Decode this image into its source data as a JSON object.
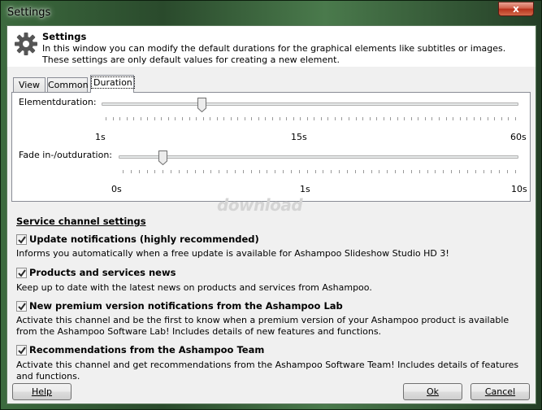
{
  "window": {
    "title": "Settings",
    "close_glyph": "x"
  },
  "header": {
    "title": "Settings",
    "description": "In this window you can modify the default durations for the graphical elements like subtitles or images. These settings are only default values for creating a new element.",
    "icon": "gear-icon"
  },
  "tabs": [
    {
      "label": "View",
      "active": false
    },
    {
      "label": "Common",
      "active": false
    },
    {
      "label": "Duration",
      "active": true
    }
  ],
  "duration": {
    "element": {
      "label": "Elementduration:",
      "min_label": "1s",
      "mid_label": "15s",
      "max_label": "60s",
      "value_fraction": 0.24
    },
    "fade": {
      "label": "Fade in-/outduration:",
      "min_label": "0s",
      "mid_label": "1s",
      "max_label": "10s",
      "value_fraction": 0.11
    }
  },
  "watermark": "download",
  "service": {
    "title": "Service channel settings",
    "items": [
      {
        "label": "Update notifications (highly recommended)",
        "checked": true,
        "description": "Informs you automatically when a free update is available for Ashampoo Slideshow Studio HD 3!"
      },
      {
        "label": "Products and services news",
        "checked": true,
        "description": "Keep up to date with the latest news on products and services from Ashampoo."
      },
      {
        "label": "New premium version notifications from the Ashampoo Lab",
        "checked": true,
        "description": "Activate this channel and be the first to know when a premium version of your Ashampoo product is available from the Ashampoo Software Lab! Includes details of new features and functions."
      },
      {
        "label": "Recommendations from the Ashampoo Team",
        "checked": true,
        "description": "Activate this channel and get recommendations from the Ashampoo Software Team! Includes details of features and functions."
      }
    ]
  },
  "buttons": {
    "help": "Help",
    "ok": "Ok",
    "cancel": "Cancel"
  },
  "colors": {
    "titlebar_glass": "#3c6a3e",
    "close_red": "#c8452e",
    "panel_bg": "#f0f0f0"
  }
}
